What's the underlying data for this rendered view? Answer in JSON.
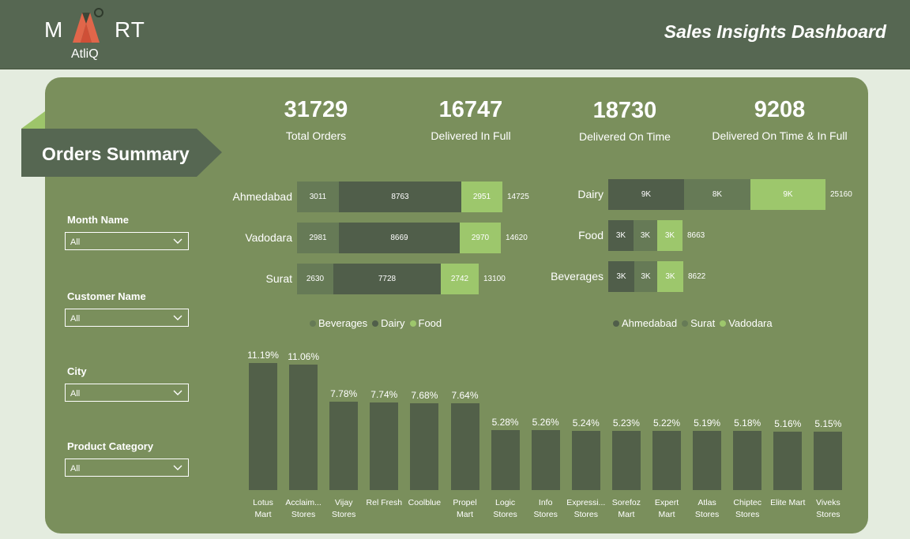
{
  "header": {
    "logo_left": "M",
    "logo_right": "RT",
    "logo_sub": "AtliQ",
    "title": "Sales Insights Dashboard"
  },
  "section_title": "Orders Summary",
  "kpis": [
    {
      "value": "31729",
      "label": "Total Orders"
    },
    {
      "value": "16747",
      "label": "Delivered In Full"
    },
    {
      "value": "18730",
      "label": "Delivered On Time"
    },
    {
      "value": "9208",
      "label": "Delivered On Time & In Full"
    }
  ],
  "filters": [
    {
      "label": "Month Name",
      "value": "All"
    },
    {
      "label": "Customer Name",
      "value": "All"
    },
    {
      "label": "City",
      "value": "All"
    },
    {
      "label": "Product Category",
      "value": "All"
    }
  ],
  "colors": {
    "beverages": "#667a56",
    "dairy": "#505e4a",
    "food": "#9dc76c",
    "ahmedabad": "#505e4a",
    "surat": "#667a56",
    "vadodara": "#9dc76c",
    "column": "#526049"
  },
  "chart_data": [
    {
      "type": "bar",
      "orientation": "horizontal",
      "stacked": true,
      "categories": [
        "Ahmedabad",
        "Vadodara",
        "Surat"
      ],
      "series": [
        {
          "name": "Beverages",
          "values": [
            3011,
            2981,
            2630
          ],
          "labels": [
            "3011",
            "2981",
            "2630"
          ]
        },
        {
          "name": "Dairy",
          "values": [
            8763,
            8669,
            7728
          ],
          "labels": [
            "8763",
            "8669",
            "7728"
          ]
        },
        {
          "name": "Food",
          "values": [
            2951,
            2970,
            2742
          ],
          "labels": [
            "2951",
            "2970",
            "2742"
          ]
        }
      ],
      "totals": [
        "14725",
        "14620",
        "13100"
      ],
      "legend": "bottom"
    },
    {
      "type": "bar",
      "orientation": "horizontal",
      "stacked": true,
      "categories": [
        "Dairy",
        "Food",
        "Beverages"
      ],
      "series": [
        {
          "name": "Ahmedabad",
          "values": [
            8763,
            2951,
            3011
          ],
          "labels": [
            "9K",
            "3K",
            "3K"
          ]
        },
        {
          "name": "Surat",
          "values": [
            7728,
            2742,
            2630
          ],
          "labels": [
            "8K",
            "3K",
            "3K"
          ]
        },
        {
          "name": "Vadodara",
          "values": [
            8669,
            2970,
            2981
          ],
          "labels": [
            "9K",
            "3K",
            "3K"
          ]
        }
      ],
      "totals": [
        "25160",
        "8663",
        "8622"
      ],
      "legend": "bottom"
    },
    {
      "type": "bar",
      "orientation": "vertical",
      "categories": [
        "Lotus\nMart",
        "Acclaim...\nStores",
        "Vijay\nStores",
        "Rel Fresh",
        "Coolblue",
        "Propel\nMart",
        "Logic\nStores",
        "Info\nStores",
        "Expressi...\nStores",
        "Sorefoz\nMart",
        "Expert\nMart",
        "Atlas\nStores",
        "Chiptec\nStores",
        "Elite Mart",
        "Viveks\nStores"
      ],
      "values": [
        11.19,
        11.06,
        7.78,
        7.74,
        7.68,
        7.64,
        5.28,
        5.26,
        5.24,
        5.23,
        5.22,
        5.19,
        5.18,
        5.16,
        5.15
      ],
      "labels": [
        "11.19%",
        "11.06%",
        "7.78%",
        "7.74%",
        "7.68%",
        "7.64%",
        "5.28%",
        "5.26%",
        "5.24%",
        "5.23%",
        "5.22%",
        "5.19%",
        "5.18%",
        "5.16%",
        "5.15%"
      ],
      "legend": "none"
    }
  ]
}
